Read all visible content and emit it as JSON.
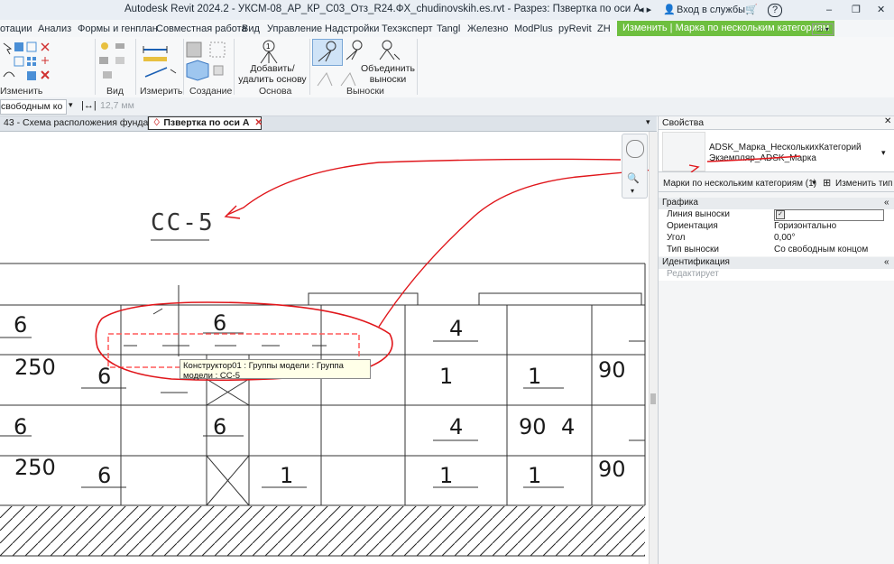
{
  "titlebar": {
    "title": "Autodesk Revit 2024.2 - УКСМ-08_АР_КР_С03_Отз_R24.ФХ_chudinovskih.es.rvt - Разрез: Пзвертка по оси А",
    "sign_in": "Вход в службы",
    "help": "?"
  },
  "ribbon_tabs": [
    "отации",
    "Анализ",
    "Формы и генплан",
    "Совместная работа",
    "Вид",
    "Управление",
    "Надстройки",
    "Техэксперт",
    "Tangl",
    "Железно",
    "ModPlus",
    "pyRevit",
    "ZH",
    "Изменить | Марка по нескольким категориям"
  ],
  "ribbon": {
    "panels": [
      "Изменить",
      "Вид",
      "Измерить",
      "Создание",
      "Основа",
      "Выноски"
    ],
    "add_remove_host": "Добавить/удалить основу",
    "merge_leaders": "Объединить выноски"
  },
  "options_bar": {
    "leader_type": "свободным ко",
    "length": "12,7 мм"
  },
  "view_tabs": {
    "tab1": "43 - Схема расположения фундам...",
    "tab2": "Пзвертка по оси А"
  },
  "drawing": {
    "section_title": "СС-5",
    "tooltip": "Конструктор01 : Группы модели : Группа модели : СС-5",
    "labels_row1": [
      "6",
      "6",
      "4"
    ],
    "labels_row2": [
      "250",
      "6",
      "1",
      "1",
      "90"
    ],
    "labels_row3": [
      "6",
      "6",
      "4",
      "90",
      "4"
    ],
    "labels_row4": [
      "250",
      "6",
      "1",
      "1",
      "1",
      "90"
    ]
  },
  "properties": {
    "header": "Свойства",
    "family": "ADSK_Марка_НесколькихКатегорий",
    "type": "Экземпляр_ADSK_Марка",
    "selector": "Марки по нескольким категориям (1)",
    "edit_type": "Изменить тип",
    "group_graphics": "Графика",
    "rows": [
      {
        "key": "Линия выноски",
        "value": ""
      },
      {
        "key": "Ориентация",
        "value": "Горизонтально"
      },
      {
        "key": "Угол",
        "value": "0,00°"
      },
      {
        "key": "Тип выноски",
        "value": "Со свободным концом"
      }
    ],
    "group_identity": "Идентификация",
    "editable_row": "Редактирует"
  },
  "colors": {
    "ribbon_context": "#6ebf3f",
    "annotation_red": "#e0161b",
    "selection_red": "#ff5a5a"
  }
}
